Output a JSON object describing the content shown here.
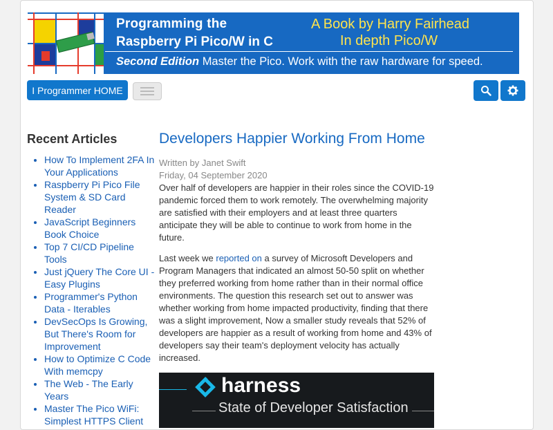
{
  "banner": {
    "title_line1": "Programming the",
    "title_line2": "Raspberry Pi Pico/W in C",
    "tag_line1": "A Book by Harry Fairhead",
    "tag_line2": "In depth Pico/W",
    "edition": "Second Edition",
    "tagline": "Master the Pico. Work with the raw hardware for speed."
  },
  "toolbar": {
    "home_label": "I Programmer HOME",
    "search_icon": "search-icon",
    "settings_icon": "gear-icon"
  },
  "sidebar": {
    "heading": "Recent Articles",
    "items": [
      "How To Implement 2FA In Your Applications",
      "Raspberry Pi Pico File System & SD Card Reader",
      "JavaScript Beginners Book Choice",
      "Top 7 CI/CD Pipeline Tools",
      "Just jQuery The Core UI - Easy Plugins",
      "Programmer's Python Data - Iterables",
      "DevSecOps Is Growing, But There's Room for Improvement",
      "How to Optimize C Code With memcpy",
      "The Web - The Early Years",
      "Master The Pico WiFi: Simplest HTTPS Client"
    ]
  },
  "article": {
    "title": "Developers Happier Working From Home",
    "author": "Written by Janet Swift",
    "date": "Friday, 04 September 2020",
    "para1": "Over half of developers are happier in their roles since the COVID-19 pandemic forced them to work remotely. The overwhelming majority are satisfied with their employers and at least three quarters anticipate they will be able to continue to work from home in the future.",
    "para2_before": "Last week we ",
    "para2_link": "reported on",
    "para2_after": " a survey of Microsoft Developers and Program Managers that indicated an almost 50-50 split on whether they preferred working from home rather than in their normal office environments. The question this research set out to answer was whether working from home impacted productivity, finding that there was a slight improvement, Now a smaller study reveals that 52% of developers are happier as a result of working from home and 43% of developers say their team's deployment velocity has actually increased.",
    "hero_brand": "harness",
    "hero_subtitle": "State of Developer Satisfaction"
  },
  "colors": {
    "accent": "#1177cc",
    "link": "#1a5fb4",
    "banner_bg": "#1769c2",
    "banner_highlight": "#ffe44d"
  }
}
